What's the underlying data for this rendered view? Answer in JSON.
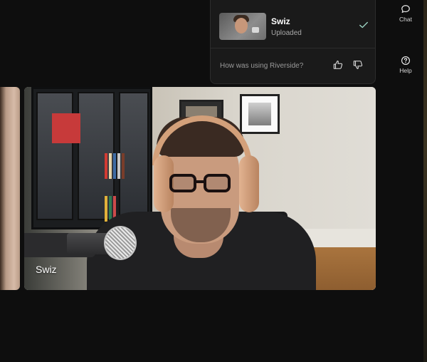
{
  "rail": {
    "chat_label": "Chat",
    "help_label": "Help"
  },
  "popup": {
    "participant_name": "Swiz",
    "participant_status": "Uploaded",
    "feedback_question": "How was using Riverside?"
  },
  "tiles": {
    "main_label": "Swiz"
  },
  "colors": {
    "background": "#0e0e0e",
    "panel": "#1a1a1a",
    "check": "#9ad0c0"
  }
}
